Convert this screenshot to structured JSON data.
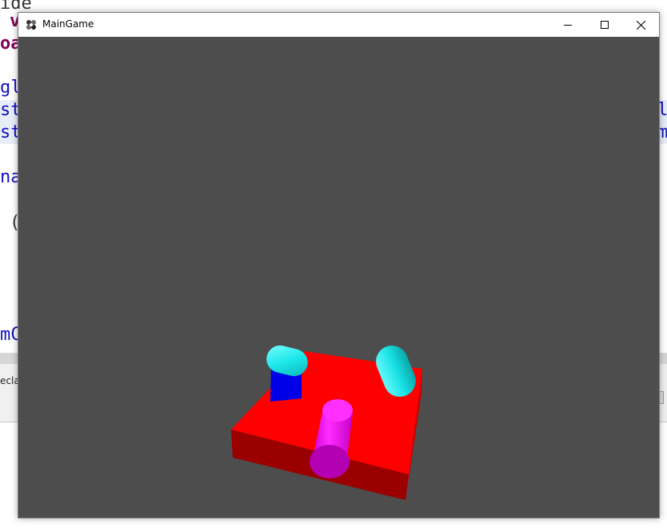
{
  "background_editor": {
    "line1": "ide",
    "line2": "v",
    "line3": "oa",
    "line4": "gl",
    "line5": "st",
    "line6": "st",
    "line7": "na",
    "line8": "(",
    "line9": "mC",
    "right5": "l",
    "right6": "m",
    "bottom_tab": "ecla"
  },
  "window": {
    "title": "MainGame",
    "icons": {
      "app": "app-icon",
      "minimize": "minimize-icon",
      "maximize": "maximize-icon",
      "close": "close-icon"
    }
  },
  "scene": {
    "background_color": "#4d4d4d",
    "objects": [
      {
        "name": "platform",
        "color": "#ff0000"
      },
      {
        "name": "cube",
        "color": "#0000ff"
      },
      {
        "name": "capsule-left",
        "color": "#00e5e5"
      },
      {
        "name": "capsule-right",
        "color": "#00e5e5"
      },
      {
        "name": "cylinder",
        "color": "#ff00ff"
      }
    ]
  }
}
